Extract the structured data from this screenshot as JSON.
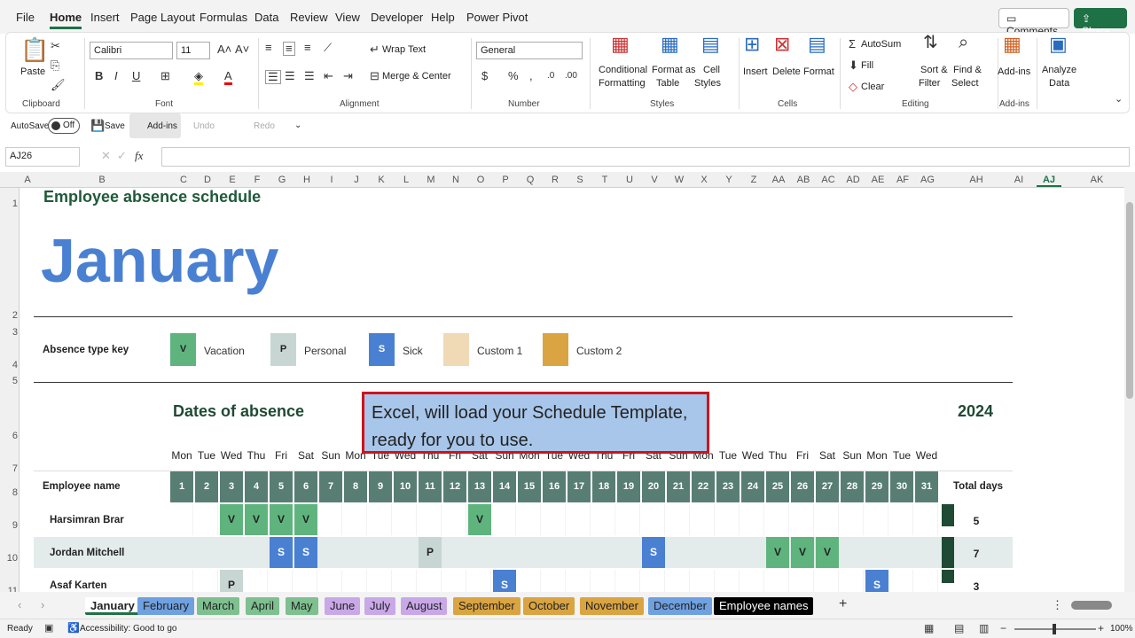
{
  "menu": [
    "File",
    "Home",
    "Insert",
    "Page Layout",
    "Formulas",
    "Data",
    "Review",
    "View",
    "Developer",
    "Help",
    "Power Pivot"
  ],
  "top_buttons": {
    "comments": "Comments",
    "share": "Share"
  },
  "ribbon": {
    "clipboard": {
      "paste": "Paste",
      "label": "Clipboard"
    },
    "font": {
      "name": "Calibri",
      "size": "11",
      "label": "Font"
    },
    "alignment": {
      "wrap": "Wrap Text",
      "merge": "Merge & Center",
      "label": "Alignment"
    },
    "number": {
      "format": "General",
      "label": "Number"
    },
    "styles": {
      "cond1": "Conditional",
      "cond2": "Formatting",
      "fmt1": "Format as",
      "fmt2": "Table",
      "cell1": "Cell",
      "cell2": "Styles",
      "label": "Styles"
    },
    "cells": {
      "insert": "Insert",
      "delete": "Delete",
      "format": "Format",
      "label": "Cells"
    },
    "editing": {
      "autosum": "AutoSum",
      "fill": "Fill",
      "clear": "Clear",
      "sort1": "Sort &",
      "sort2": "Filter",
      "find1": "Find &",
      "find2": "Select",
      "label": "Editing"
    },
    "addins": {
      "btn": "Add-ins",
      "label": "Add-ins"
    },
    "analyze": {
      "l1": "Analyze",
      "l2": "Data"
    }
  },
  "qat": {
    "autosave": "AutoSave",
    "toggle": "Off",
    "save": "Save",
    "addins": "Add-ins",
    "undo": "Undo",
    "redo": "Redo"
  },
  "formula_bar": {
    "name_box": "AJ26",
    "fx": "fx",
    "value": ""
  },
  "columns": [
    "A",
    "B",
    "C",
    "D",
    "E",
    "F",
    "G",
    "H",
    "I",
    "J",
    "K",
    "L",
    "M",
    "N",
    "O",
    "P",
    "Q",
    "R",
    "S",
    "T",
    "U",
    "V",
    "W",
    "X",
    "Y",
    "Z",
    "AA",
    "AB",
    "AC",
    "AD",
    "AE",
    "AF",
    "AG",
    "AH",
    "AI",
    "AJ",
    "AK"
  ],
  "rows": [
    "1",
    "2",
    "3",
    "4",
    "5",
    "6",
    "7",
    "8",
    "9",
    "10",
    "11"
  ],
  "sheet": {
    "heading": "Employee absence schedule",
    "month": "January",
    "key_label": "Absence type key",
    "keys": [
      {
        "code": "V",
        "label": "Vacation",
        "color": "#5fb47e"
      },
      {
        "code": "P",
        "label": "Personal",
        "color": "#c7d6d2"
      },
      {
        "code": "S",
        "label": "Sick",
        "color": "#4a80d2"
      },
      {
        "code": "",
        "label": "Custom 1",
        "color": "#f0d9b5"
      },
      {
        "code": "",
        "label": "Custom 2",
        "color": "#d9a441"
      }
    ],
    "dates_title": "Dates of absence",
    "year": "2024",
    "weekdays": [
      "Mon",
      "Tue",
      "Wed",
      "Thu",
      "Fri",
      "Sat",
      "Sun",
      "Mon",
      "Tue",
      "Wed",
      "Thu",
      "Fri",
      "Sat",
      "Sun",
      "Mon",
      "Tue",
      "Wed",
      "Thu",
      "Fri",
      "Sat",
      "Sun",
      "Mon",
      "Tue",
      "Wed",
      "Thu",
      "Fri",
      "Sat",
      "Sun",
      "Mon",
      "Tue",
      "Wed"
    ],
    "emp_header": "Employee name",
    "total_header": "Total days",
    "employees": [
      {
        "name": "Harsimran Brar",
        "total": "5",
        "absences": {
          "3": "V",
          "4": "V",
          "5": "V",
          "6": "V",
          "13": "V"
        }
      },
      {
        "name": "Jordan Mitchell",
        "total": "7",
        "absences": {
          "5": "S",
          "6": "S",
          "11": "P",
          "20": "S",
          "25": "V",
          "26": "V",
          "27": "V"
        }
      },
      {
        "name": "Asaf Karten",
        "total": "3",
        "absences": {
          "3": "P",
          "14": "S",
          "29": "S"
        }
      }
    ]
  },
  "callout": "Excel, will load your Schedule Template, ready for you to use.",
  "sheet_tabs": [
    {
      "label": "January",
      "active": true,
      "color": "#ffffff"
    },
    {
      "label": "February",
      "color": "#6fa0e0"
    },
    {
      "label": "March",
      "color": "#7ec090"
    },
    {
      "label": "April",
      "color": "#7ec090"
    },
    {
      "label": "May",
      "color": "#7ec090"
    },
    {
      "label": "June",
      "color": "#c9a8e8"
    },
    {
      "label": "July",
      "color": "#c9a8e8"
    },
    {
      "label": "August",
      "color": "#c9a8e8"
    },
    {
      "label": "September",
      "color": "#d9a441"
    },
    {
      "label": "October",
      "color": "#d9a441"
    },
    {
      "label": "November",
      "color": "#d9a441"
    },
    {
      "label": "December",
      "color": "#6fa0e0"
    },
    {
      "label": "Employee names",
      "color": "#000000"
    }
  ],
  "status": {
    "ready": "Ready",
    "accessibility": "Accessibility: Good to go",
    "zoom": "100%"
  }
}
